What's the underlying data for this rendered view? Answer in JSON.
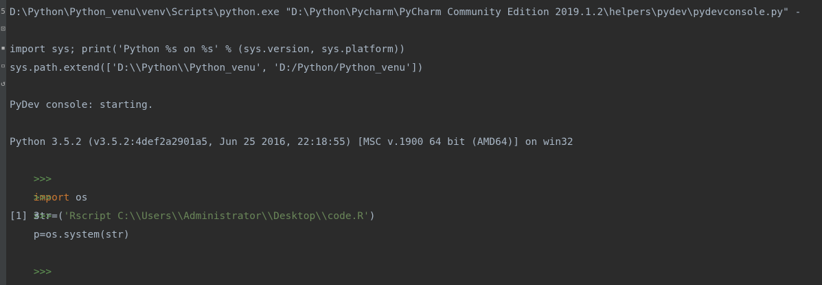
{
  "gutter": {
    "icons": [
      {
        "name": "rerun-icon",
        "glyph": "5"
      },
      {
        "name": "stop-icon",
        "glyph": "⊡"
      },
      {
        "name": "soft-wrap-icon",
        "glyph": "▪"
      },
      {
        "name": "print-icon",
        "glyph": "▫"
      },
      {
        "name": "history-icon",
        "glyph": "↺"
      }
    ]
  },
  "console": {
    "command_line": "D:\\Python\\Python_venu\\venv\\Scripts\\python.exe \"D:\\Python\\Pycharm\\PyCharm Community Edition 2019.1.2\\helpers\\pydev\\pydevconsole.py\" -",
    "init_line1": "import sys; print('Python %s on %s' % (sys.version, sys.platform))",
    "init_line2": "sys.path.extend(['D:\\\\Python\\\\Python_venu', 'D:/Python/Python_venu'])",
    "starting": "PyDev console: starting.",
    "python_version": "Python 3.5.2 (v3.5.2:4def2a2901a5, Jun 25 2016, 22:18:55) [MSC v.1900 64 bit (AMD64)] on win32",
    "prompt": ">>>",
    "in1_kw": "import",
    "in1_rest": " os",
    "in2_pre": "str=(",
    "in2_str": "'Rscript C:\\\\Users\\\\Administrator\\\\Desktop\\\\code.R'",
    "in2_post": ")",
    "in3": "p=os.system(str)",
    "output": "[1] 3"
  }
}
